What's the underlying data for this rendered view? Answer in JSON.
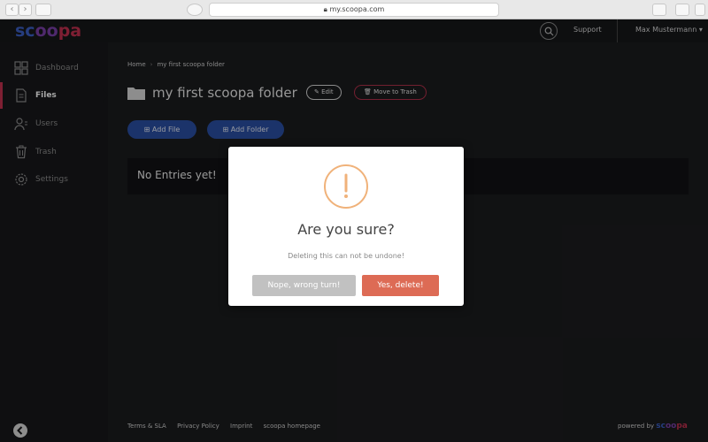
{
  "browser": {
    "url": "my.scoopa.com",
    "back_glyph": "‹",
    "forward_glyph": "›"
  },
  "header": {
    "logo": {
      "part1": "sc",
      "part2": "oo",
      "part3": "pa"
    },
    "support_label": "Support",
    "user_name": "Max Mustermann",
    "user_caret": "▾"
  },
  "sidebar": {
    "items": [
      {
        "label": "Dashboard",
        "icon": "dashboard-icon"
      },
      {
        "label": "Files",
        "icon": "files-icon",
        "active": true
      },
      {
        "label": "Users",
        "icon": "users-icon"
      },
      {
        "label": "Trash",
        "icon": "trash-icon"
      },
      {
        "label": "Settings",
        "icon": "settings-icon"
      }
    ]
  },
  "breadcrumb": {
    "home": "Home",
    "separator": "›",
    "current": "my first scoopa folder"
  },
  "page": {
    "title": "my first scoopa folder",
    "edit_label": "Edit",
    "trash_label": "Move to Trash",
    "add_file_label": "Add File",
    "add_folder_label": "Add Folder",
    "empty_text": "No Entries yet!"
  },
  "footer": {
    "links": [
      "Terms & SLA",
      "Privacy Policy",
      "Imprint",
      "scoopa homepage"
    ],
    "powered_by": "powered by",
    "powered_logo": {
      "part1": "sc",
      "part2": "oo",
      "part3": "pa"
    }
  },
  "modal": {
    "title": "Are you sure?",
    "text": "Deleting this can not be undone!",
    "cancel_label": "Nope, wrong turn!",
    "confirm_label": "Yes, delete!"
  },
  "colors": {
    "accent_red": "#c2304f",
    "primary_blue": "#2a4fa3",
    "confirm": "#dd6b55",
    "cancel": "#c1c1c1",
    "warning": "#f0b27a"
  }
}
